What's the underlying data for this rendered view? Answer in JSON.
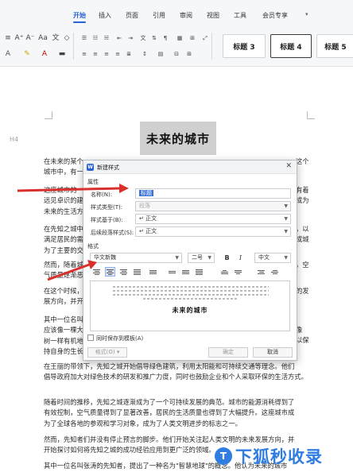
{
  "ribbon": {
    "tabs": [
      "开始",
      "插入",
      "页面",
      "引用",
      "审阅",
      "视图",
      "工具",
      "会员专享"
    ],
    "active_tab": "开始",
    "styles": [
      "标题 3",
      "标题 4",
      "标题 5"
    ],
    "selected_style": "标题 4",
    "accent_color": "#2a62d6"
  },
  "document": {
    "title": "未来的城市",
    "heading_marker": "H4",
    "paragraphs": [
      {
        "lines": [
          "在未来的某个",
          "城市中，有一"
        ]
      },
      {
        "lines": [
          "这座城市的",
          "远见卓识的建",
          "未来的生活方"
        ]
      },
      {
        "lines": [
          "在先知之城中",
          "满足居民的需",
          "为了主要的交"
        ]
      },
      {
        "lines": [
          "然而，随着城",
          "气质量逐渐恶"
        ]
      },
      {
        "lines": [
          "在这个时候，",
          "展方向，并开"
        ]
      },
      {
        "lines": [
          "其中一位名叫",
          "应该像一棵大",
          "树一样有机地",
          "持自身的生长"
        ]
      },
      {
        "lines": [
          "在王丽的带领下，先知之城开始倡导绿色建筑，利用太阳能和可持续交通等理念。他们",
          "倡导政府加大对绿色技术的研发和推广力度，同时也鼓励企业和个人采取环保的生活方式。"
        ]
      },
      {
        "lines": [
          "随着时间的推移，先知之城逐渐成为了一个可持续发展的典范。城市的能源消耗得到了",
          "有效控制，空气质量得到了显著改善，居民的生活质量也得到了大幅提升。这座城市成",
          "为了全球各地的参观和学习对象，成为了人类文明进步的标志之一。"
        ]
      },
      {
        "lines": [
          "然而，先知者们并没有停止预言的脚步。他们开始关注起人类文明的未来发展方向，并",
          "开始探讨如何将先知之城的成功经验应用到更广泛的领域。"
        ]
      },
      {
        "lines": [
          "其中一位名叫张涛的先知者，提出了一种名为\"智慧地球\"的概念。他认为未来的城市"
        ]
      }
    ],
    "right_fragments": [
      "这个",
      "有着",
      "成为",
      "，以",
      "成城",
      "，空",
      "的发",
      "像",
      "以保"
    ]
  },
  "dialog": {
    "title": "新建样式",
    "section_properties": "属性",
    "name_label": "名称(N):",
    "name_value": "标题",
    "style_type_label": "样式类型(T):",
    "style_type_value": "段落",
    "based_on_label": "样式基于(B):",
    "based_on_value": "↵ 正文",
    "following_label": "后续段落样式(S):",
    "following_value": "↵ 正文",
    "section_format": "格式",
    "font_name": "华文新魏",
    "font_size": "二号",
    "bold": "B",
    "italic": "I",
    "language": "中文",
    "preview_text": "未来的城市",
    "checkbox_label": "同时保存到模板(A)",
    "format_button": "格式(O)",
    "ok_button": "确定",
    "cancel_button": "取消"
  },
  "watermark": {
    "text": "下狐秒收录",
    "logo_glyph": "T",
    "color": "#2f7de1"
  },
  "annotations": {
    "arrow_color": "#d9302c"
  }
}
